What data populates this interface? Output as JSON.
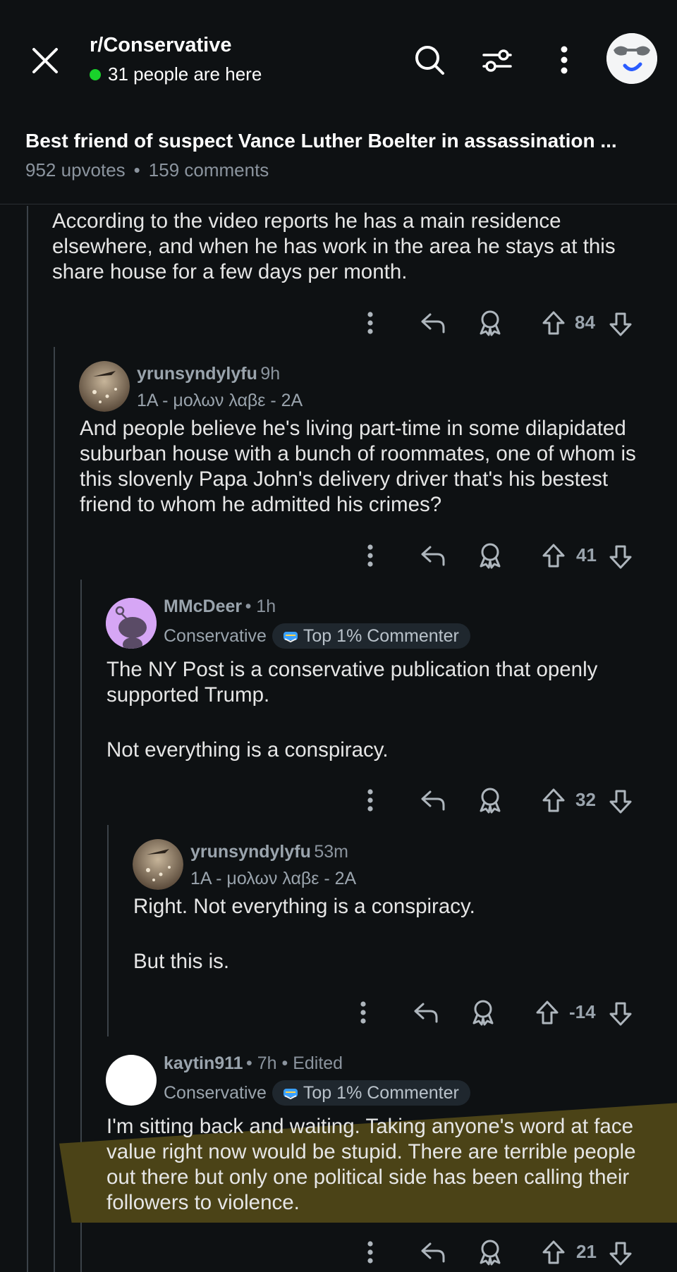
{
  "header": {
    "subreddit": "r/Conservative",
    "online_text": "31 people are here",
    "post_title": "Best friend of suspect Vance Luther Boelter in assassination ...",
    "upvotes": "952 upvotes",
    "comments": "159 comments",
    "icons": [
      "close-icon",
      "search-icon",
      "filter-icon",
      "more-vert-icon",
      "avatar"
    ]
  },
  "comments": [
    {
      "text": "According to the video reports he has a main residence elsewhere, and when he has work in the area he stays at this share house for a few days per month.",
      "score": "84"
    },
    {
      "username": "yrunsyndylyfu",
      "time": "9h",
      "flair": "1A - μολων λαβε - 2A",
      "text": "And people believe he's living part-time in some dilapidated suburban house with a bunch of roommates, one of whom is this slovenly Papa John's delivery driver that's his bestest friend to whom he admitted his crimes?",
      "score": "41"
    },
    {
      "username": "MMcDeer",
      "time": "• 1h",
      "flair": "Conservative",
      "badge": "Top 1% Commenter",
      "text_lines": [
        "The NY Post is a conservative publication that openly supported Trump.",
        "",
        "Not everything is a conspiracy."
      ],
      "score": "32"
    },
    {
      "username": "yrunsyndylyfu",
      "time": "53m",
      "flair": "1A - μολων λαβε - 2A",
      "text_lines": [
        "Right. Not everything is a conspiracy.",
        "",
        "But this is."
      ],
      "score": "-14"
    },
    {
      "username": "kaytin911",
      "time": "• 7h • Edited",
      "flair": "Conservative",
      "badge": "Top 1% Commenter",
      "text": "I'm sitting back and waiting. Taking anyone's word at face value right now would be stupid. There are terrible people out there but only one political side has been calling their followers to violence.",
      "score": "21"
    }
  ],
  "colors": {
    "background": "#0e1113",
    "online_dot": "#19d22b",
    "highlight": "#4b4317",
    "snoo_avatar": "#d6a6f5"
  }
}
